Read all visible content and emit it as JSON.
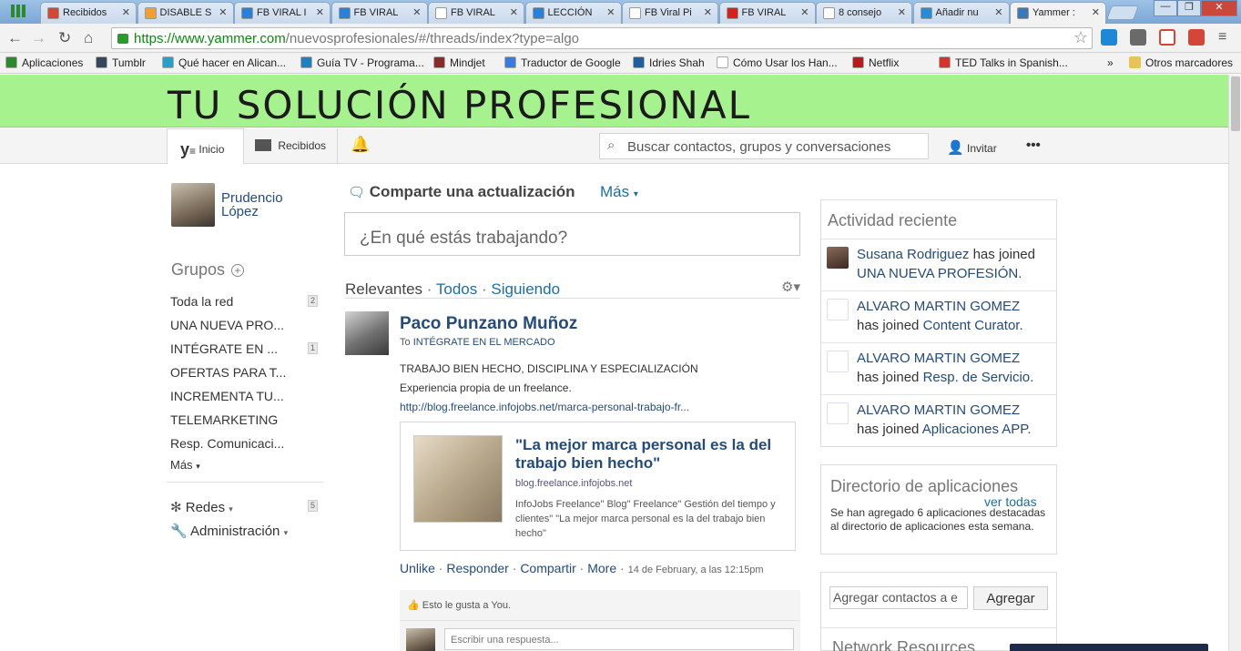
{
  "browser": {
    "tabs": [
      {
        "label": "Recibidos",
        "icon": "gmail-icon",
        "color": "#d44638"
      },
      {
        "label": "DISABLE S",
        "icon": "rss-icon",
        "color": "#f0a030"
      },
      {
        "label": "FB VIRAL I",
        "icon": "chart-icon",
        "color": "#2a7fd6"
      },
      {
        "label": "FB VIRAL",
        "icon": "chart-icon",
        "color": "#2a7fd6"
      },
      {
        "label": "FB VIRAL",
        "icon": "document-icon",
        "color": "#ffffff"
      },
      {
        "label": "LECCIÓN",
        "icon": "chart-icon",
        "color": "#2a7fd6"
      },
      {
        "label": "FB Viral Pi",
        "icon": "document-icon",
        "color": "#ffffff"
      },
      {
        "label": "FB VIRAL",
        "icon": "youtube-icon",
        "color": "#d62020"
      },
      {
        "label": "8 consejo",
        "icon": "document-icon",
        "color": "#ffffff"
      },
      {
        "label": "Añadir nu",
        "icon": "hash-icon",
        "color": "#2a8ad6"
      },
      {
        "label": "Yammer :",
        "icon": "yammer-icon",
        "color": "#3a78b8"
      }
    ],
    "url_host": "https://www.yammer.com",
    "url_path": "/nuevosprofesionales/#/threads/index?type=algo",
    "bookmarks": [
      "Aplicaciones",
      "Tumblr",
      "Qué hacer en Alican...",
      "Guía TV - Programa...",
      "Mindjet",
      "Traductor de Google",
      "Idries Shah",
      "Cómo Usar los Han...",
      "Netflix",
      "TED Talks in Spanish..."
    ],
    "bookmarks_more": "»",
    "other_bookmarks": "Otros marcadores"
  },
  "banner": {
    "title": "TU SOLUCIÓN PROFESIONAL"
  },
  "header": {
    "inicio": "Inicio",
    "recibidos": "Recibidos",
    "search_placeholder": "Buscar contactos, grupos y conversaciones",
    "invitar": "Invitar",
    "more": "•••"
  },
  "sidebar": {
    "user_first": "Prudencio",
    "user_last": "López",
    "groups_title": "Grupos",
    "groups": [
      {
        "label": "Toda la red",
        "count": "2"
      },
      {
        "label": "UNA NUEVA PRO...",
        "count": ""
      },
      {
        "label": "INTÉGRATE EN ...",
        "count": "1"
      },
      {
        "label": "OFERTAS PARA T...",
        "count": ""
      },
      {
        "label": "INCREMENTA TU...",
        "count": ""
      },
      {
        "label": "TELEMARKETING",
        "count": ""
      },
      {
        "label": "Resp. Comunicaci...",
        "count": ""
      }
    ],
    "more": "Más",
    "redes": "Redes",
    "redes_count": "5",
    "admin": "Administración"
  },
  "feed": {
    "share_title": "Comparte una actualización",
    "share_more": "Más",
    "share_placeholder": "¿En qué estás trabajando?",
    "filter_relevantes": "Relevantes",
    "filter_todos": "Todos",
    "filter_siguiendo": "Siguiendo",
    "sep": "·",
    "post": {
      "author": "Paco Punzano Muñoz",
      "to_prefix": "To",
      "to_group": "INTÉGRATE EN EL MERCADO",
      "line1": "TRABAJO BIEN HECHO, DISCIPLINA Y ESPECIALIZACIÓN",
      "line2": "Experiencia propia de un freelance.",
      "link": "http://blog.freelance.infojobs.net/marca-personal-trabajo-fr...",
      "card_title": "\"La mejor marca personal es la del trabajo bien hecho\"",
      "card_domain": "blog.freelance.infojobs.net",
      "card_desc": "InfoJobs Freelance\" Blog\" Freelance\" Gestión del tiempo y clientes\" \"La mejor marca personal es la del trabajo bien hecho\"",
      "unlike": "Unlike",
      "responder": "Responder",
      "compartir": "Compartir",
      "more": "More",
      "timestamp": "14 de February, a las 12:15pm",
      "likes": "Esto le gusta a You.",
      "reply_placeholder": "Escribir una respuesta..."
    }
  },
  "right": {
    "activity_title": "Actividad reciente",
    "activities": [
      {
        "name": "Susana Rodriguez",
        "action": "has joined",
        "group": "UNA NUEVA PROFESIÓN."
      },
      {
        "name": "ALVARO MARTIN GOMEZ",
        "action": "has joined",
        "group": "Content Curator."
      },
      {
        "name": "ALVARO MARTIN GOMEZ",
        "action": "has joined",
        "group": "Resp. de Servicio."
      },
      {
        "name": "ALVARO MARTIN GOMEZ",
        "action": "has joined",
        "group": "Aplicaciones APP."
      }
    ],
    "directory_title": "Directorio de aplicaciones",
    "directory_link": "ver todas",
    "directory_text": "Se han agregado 6 aplicaciones destacadas al directorio de aplicaciones esta semana.",
    "add_contacts_placeholder": "Agregar contactos a e",
    "add_button": "Agregar",
    "network_title": "Network Resources"
  }
}
